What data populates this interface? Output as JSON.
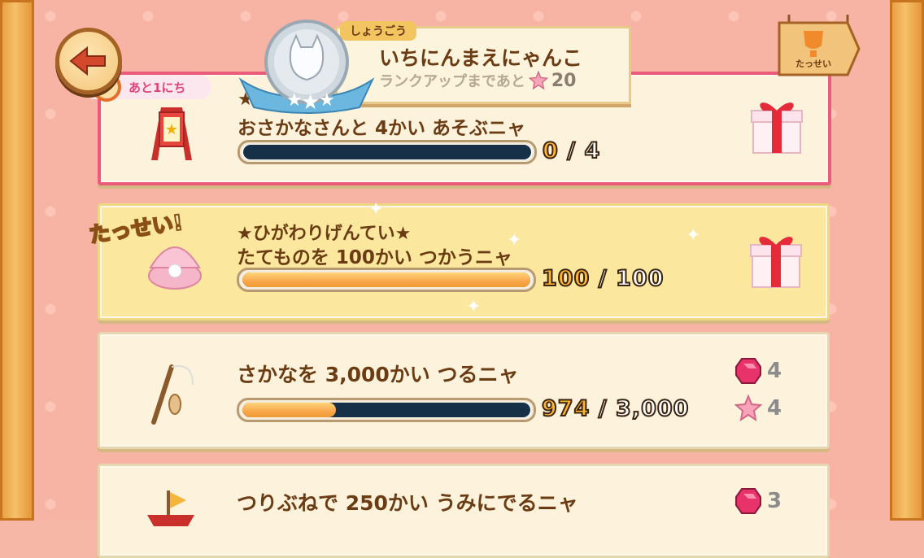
{
  "header": {
    "back_icon": "arrow-left-icon",
    "timer_label": "あと1にち",
    "rank_tag": "しょうごう",
    "rank_title": "いちにんまえにゃんこ",
    "rank_sub_label": "ランクアップまであと",
    "rank_sub_value": "20",
    "achievements_label": "たっせい"
  },
  "missions": [
    {
      "title_line1": "★",
      "title_line2": "★",
      "title": "おさかなさんと 4かい あそぶニャ",
      "current": "0",
      "total": "4",
      "progress": 0.0,
      "reward": "gift",
      "status": "active"
    },
    {
      "title_line1": "★ひがわりげんてい★",
      "title": "たてものを 100かい つかうニャ",
      "current": "100",
      "total": "100",
      "progress": 1.0,
      "reward": "gift",
      "status": "complete",
      "badge": "たっせい!"
    },
    {
      "title": "さかなを 3,000かい つるニャ",
      "current": "974",
      "total": "3,000",
      "progress": 0.3247,
      "reward_gem": "4",
      "reward_star": "4",
      "status": "in-progress"
    },
    {
      "title": "つりぶねで 250かい うみにでるニャ",
      "reward_gem": "3",
      "status": "in-progress"
    }
  ],
  "colors": {
    "accent": "#ea5c7a",
    "brown_text": "#6b3c14",
    "bar_track": "#163048",
    "bar_fill": "#f8a64b"
  }
}
